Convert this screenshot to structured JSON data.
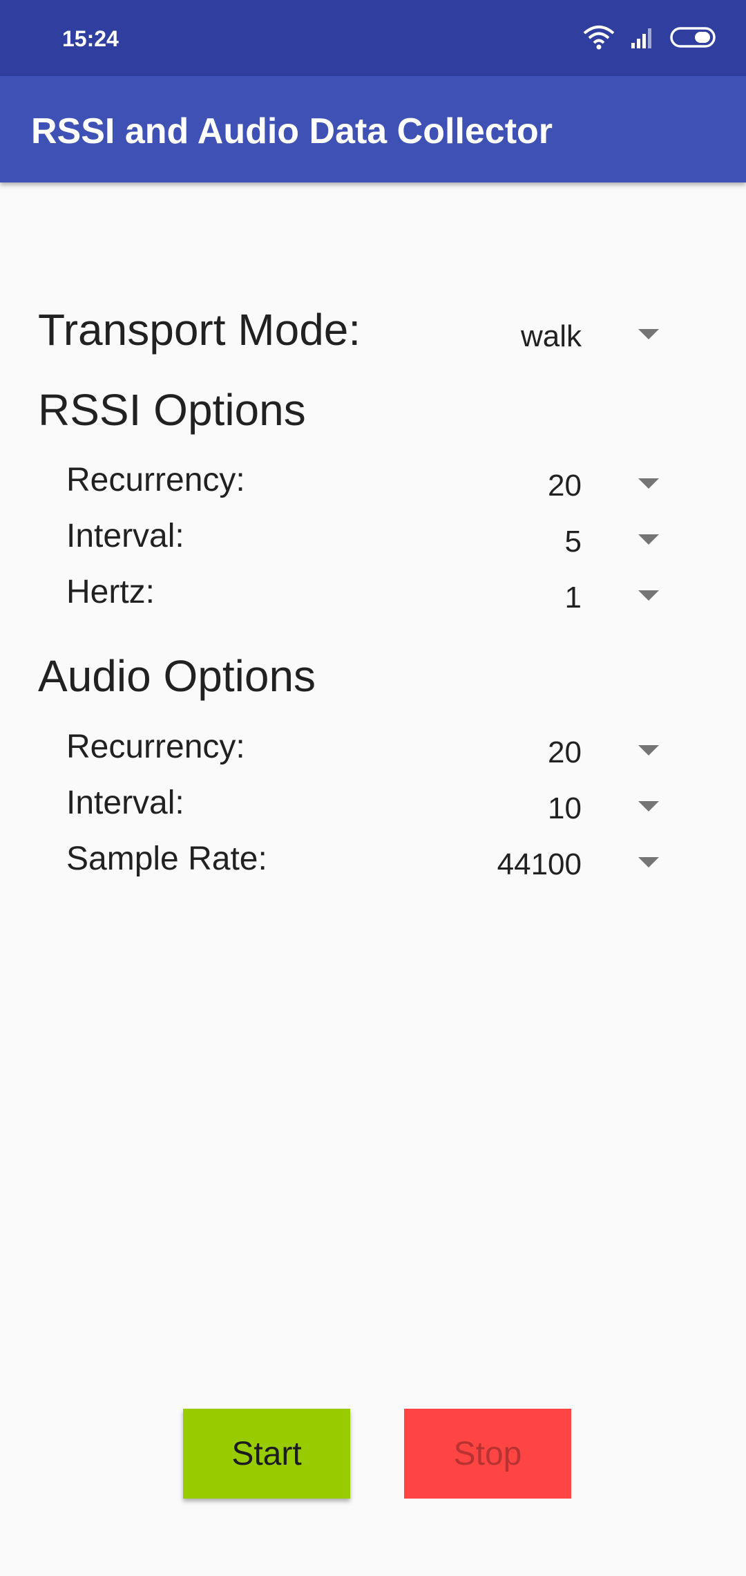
{
  "status_bar": {
    "time": "15:24",
    "icons": [
      "wifi-icon",
      "signal-icon",
      "battery-icon"
    ]
  },
  "app_bar": {
    "title": "RSSI and Audio Data Collector",
    "color": "#3f51b5",
    "status_color": "#303f9f"
  },
  "transport": {
    "label": "Transport Mode:",
    "value": "walk"
  },
  "rssi": {
    "heading": "RSSI Options",
    "recurrency": {
      "label": "Recurrency:",
      "value": "20"
    },
    "interval": {
      "label": "Interval:",
      "value": "5"
    },
    "hertz": {
      "label": "Hertz:",
      "value": "1"
    }
  },
  "audio": {
    "heading": "Audio Options",
    "recurrency": {
      "label": "Recurrency:",
      "value": "20"
    },
    "interval": {
      "label": "Interval:",
      "value": "10"
    },
    "sample_rate": {
      "label": "Sample Rate:",
      "value": "44100"
    }
  },
  "buttons": {
    "start": {
      "label": "Start",
      "color": "#99cc00"
    },
    "stop": {
      "label": "Stop",
      "color": "#ff4444"
    }
  }
}
